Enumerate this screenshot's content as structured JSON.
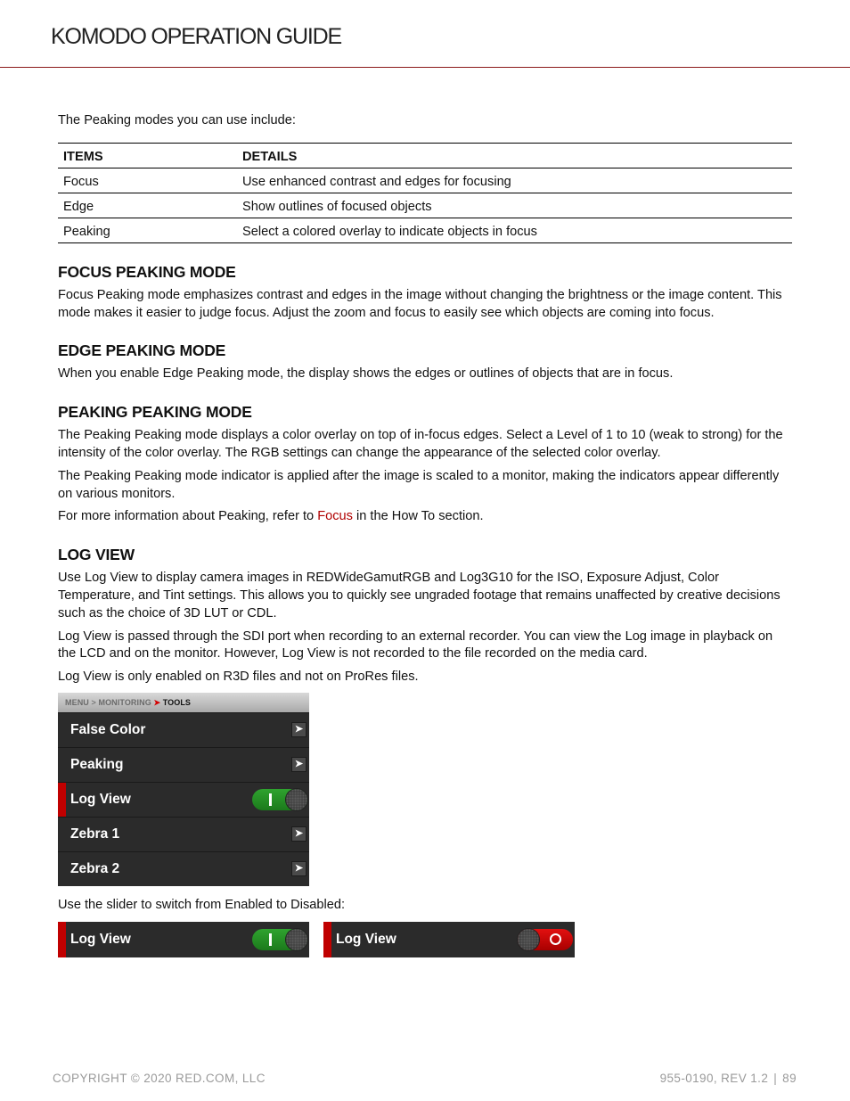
{
  "header": {
    "title": "KOMODO OPERATION GUIDE"
  },
  "intro": "The Peaking modes you can use include:",
  "table": {
    "headers": [
      "ITEMS",
      "DETAILS"
    ],
    "rows": [
      [
        "Focus",
        "Use enhanced contrast and edges for focusing"
      ],
      [
        "Edge",
        "Show outlines of focused objects"
      ],
      [
        "Peaking",
        "Select a colored overlay to indicate objects in focus"
      ]
    ]
  },
  "sections": {
    "focus": {
      "title": "FOCUS PEAKING MODE",
      "paragraphs": [
        "Focus Peaking mode emphasizes contrast and edges in the image without changing the brightness or the image content. This mode makes it easier to judge focus. Adjust the zoom and focus to easily see which objects are coming into focus."
      ]
    },
    "edge": {
      "title": "EDGE PEAKING MODE",
      "paragraphs": [
        "When you enable Edge Peaking mode, the display shows the edges or outlines of objects that are in focus."
      ]
    },
    "peaking": {
      "title": "PEAKING PEAKING MODE",
      "paragraphs": [
        "The Peaking Peaking mode displays a color overlay on top of in-focus edges. Select a Level of 1 to 10 (weak to strong) for the intensity of the color overlay. The RGB settings can change the appearance of the selected color overlay.",
        "The Peaking Peaking mode indicator is applied after the image is scaled to a monitor, making the indicators appear differently on various monitors."
      ],
      "more_prefix": "For more information about Peaking, refer to ",
      "more_link": "Focus",
      "more_suffix": " in the How To section."
    },
    "logview": {
      "title": "LOG VIEW",
      "paragraphs": [
        "Use Log View to display camera images in REDWideGamutRGB and Log3G10 for the ISO, Exposure Adjust, Color Temperature, and Tint settings. This allows you to quickly see ungraded footage that remains unaffected by creative decisions such as the choice of 3D LUT or CDL.",
        "Log View is passed through the SDI port when recording to an external recorder. You can view the Log image in playback on the LCD and on the monitor. However, Log View is not recorded to the file recorded on the media card.",
        "Log View is only enabled on R3D files and not on ProRes files."
      ]
    }
  },
  "menu": {
    "breadcrumb": [
      "MENU",
      "MONITORING",
      "TOOLS"
    ],
    "items": [
      {
        "label": "False Color",
        "type": "submenu"
      },
      {
        "label": "Peaking",
        "type": "submenu"
      },
      {
        "label": "Log View",
        "type": "toggle",
        "state": "on",
        "selected": true
      },
      {
        "label": "Zebra 1",
        "type": "submenu"
      },
      {
        "label": "Zebra 2",
        "type": "submenu"
      }
    ]
  },
  "slider_text": "Use the slider to switch from Enabled to Disabled:",
  "examples": [
    {
      "label": "Log View",
      "state": "on"
    },
    {
      "label": "Log View",
      "state": "off"
    }
  ],
  "colors": {
    "accent_red": "#c00000",
    "toggle_on": "#1c7a1c",
    "toggle_off": "#d00000",
    "link": "#b00000",
    "header_rule": "#8b1a1a"
  },
  "footer": {
    "copyright": "COPYRIGHT © 2020 RED.COM, LLC",
    "doc_rev": "955-0190, REV 1.2",
    "separator": "|",
    "page": "89"
  }
}
